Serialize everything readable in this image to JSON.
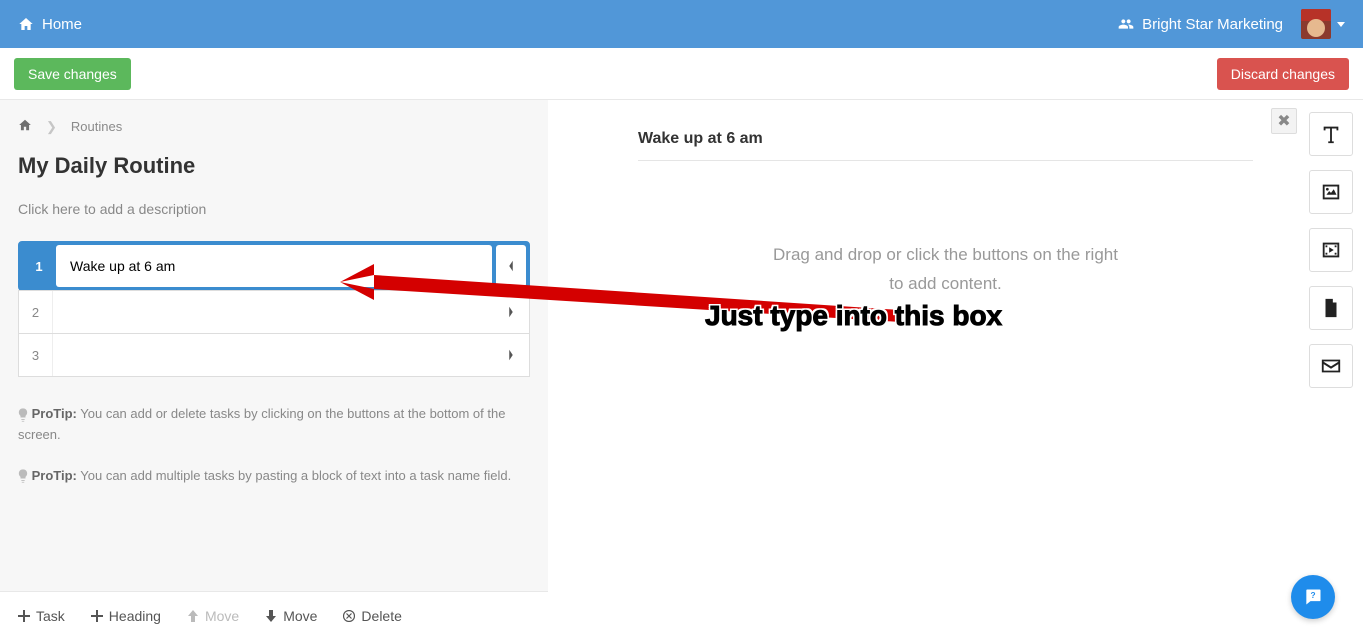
{
  "topnav": {
    "home_label": "Home",
    "org_label": "Bright Star Marketing"
  },
  "actions": {
    "save_label": "Save changes",
    "discard_label": "Discard changes"
  },
  "breadcrumb": {
    "current": "Routines"
  },
  "page": {
    "title": "My Daily Routine",
    "desc_placeholder": "Click here to add a description"
  },
  "tasks": [
    {
      "num": "1",
      "value": "Wake up at 6 am",
      "active": true
    },
    {
      "num": "2",
      "value": "",
      "active": false
    },
    {
      "num": "3",
      "value": "",
      "active": false
    }
  ],
  "protips": [
    {
      "label": "ProTip:",
      "text": " You can add or delete tasks by clicking on the buttons at the bottom of the screen."
    },
    {
      "label": "ProTip:",
      "text": " You can add multiple tasks by pasting a block of text into a task name field."
    }
  ],
  "toolbar": {
    "task": "Task",
    "heading": "Heading",
    "move_up": "Move",
    "move_down": "Move",
    "delete": "Delete"
  },
  "rightpanel": {
    "title": "Wake up at 6 am",
    "hint_line1": "Drag and drop or click the buttons on the right",
    "hint_line2": "to add content."
  },
  "annotation": {
    "text": "Just type into this box"
  }
}
